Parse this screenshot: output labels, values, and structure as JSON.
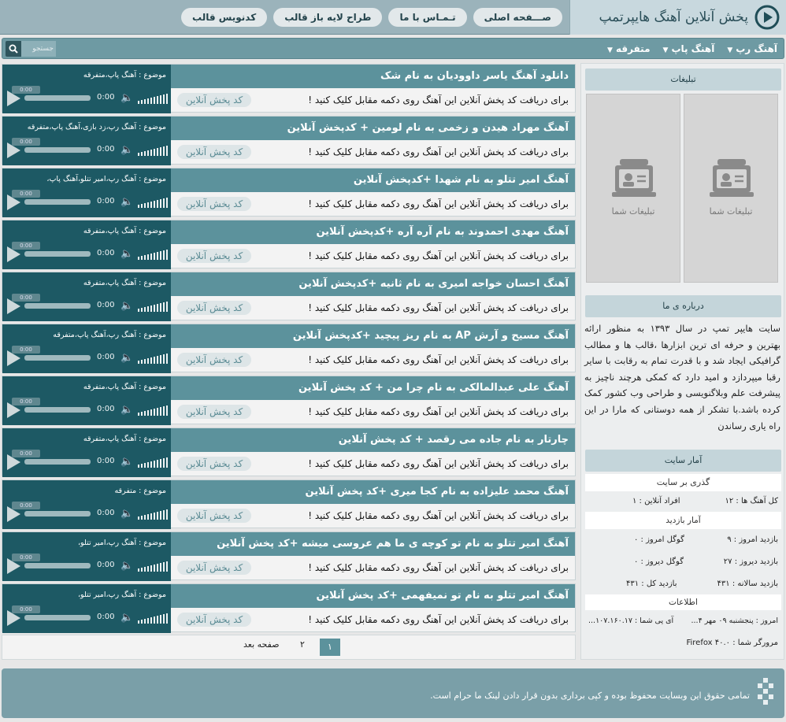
{
  "header": {
    "title": "پخش آنلاین آهنگ هایپرتمپ",
    "nav": [
      "صـــفحه اصلی",
      "تـمـاس با ما",
      "طراح لایه باز قالب",
      "کدنویس قالب"
    ]
  },
  "categories": [
    "آهنگ رپ",
    "آهنگ پاپ",
    "متفرقه"
  ],
  "search": {
    "placeholder": "جستجو"
  },
  "posts": [
    {
      "title": "دانلود آهنگ یاسر داوودیان به نام شک",
      "topic": "موضوع : آهنگ پاپ،متفرقه"
    },
    {
      "title": "آهنگ مهراد هیدن و زخمی به نام لومین + کدپخش آنلاین",
      "topic": "موضوع : آهنگ رپ،زد بازی،آهنگ پاپ،متفرقه"
    },
    {
      "title": "آهنگ امیر تتلو به نام شهدا +کدپخش آنلاین",
      "topic": "موضوع : آهنگ رپ،امیر تتلو،آهنگ پاپ،"
    },
    {
      "title": "آهنگ مهدی احمدوند به نام آره آره +کدپخش آنلاین",
      "topic": "موضوع : آهنگ پاپ،متفرقه"
    },
    {
      "title": "آهنگ احسان خواجه امیری به نام ثانیه +کدپخش آنلاین",
      "topic": "موضوع : آهنگ پاپ،متفرقه"
    },
    {
      "title": "آهنگ مسیح و آرش AP به نام ریز پیچید +کدپخش آنلاین",
      "topic": "موضوع : آهنگ رپ،آهنگ پاپ،متفرقه"
    },
    {
      "title": "آهنگ علی عبدالمالکی به نام چرا من + کد پخش آنلاین",
      "topic": "موضوع : آهنگ پاپ،متفرقه"
    },
    {
      "title": "چارتار به نام جاده می رقصد + کد پخش آنلاین",
      "topic": "موضوع : آهنگ پاپ،متفرقه"
    },
    {
      "title": "آهنگ محمد علیزاده به نام کجا میری +کد پخش آنلاین",
      "topic": "موضوع : متفرقه"
    },
    {
      "title": "آهنگ امیر تتلو به نام تو کوچه ی ما هم عروسی میشه +کد پخش آنلاین",
      "topic": "موضوع : آهنگ رپ،امیر تتلو،"
    },
    {
      "title": "آهنگ امیر تتلو به نام تو نمیفهمی +کد پخش آنلاین",
      "topic": "موضوع : آهنگ رپ،امیر تتلو،"
    }
  ],
  "post_common": {
    "desc": "برای دریافت کد پخش آنلاین این آهنگ روی دکمه مقابل کلیک کنید !",
    "code_label": "کد پخش آنلاین",
    "time": "0:00",
    "tooltip": "0:00"
  },
  "pager": {
    "current": "۱",
    "next": "۲",
    "next_label": "صفحه بعد"
  },
  "sidebar": {
    "ads": {
      "title": "تبلیغات",
      "label": "تبلیغات شما"
    },
    "about": {
      "title": "درباره ی ما",
      "text": "سایت هایپر تمپ در سال ۱۳۹۳ به منظور ارائه بهترین و حرفه ای ترین ابزارها ،قالب ها و مطالب گرافیکی ایجاد شد و با قدرت تمام به رقابت با سایر رقبا میپردازد و امید دارد که کمکی هرچند ناچیز به پیشرفت علم وبلاگنویسی و طراحی وب کشور کمک کرده باشد.با تشکر از همه دوستانی که مارا در این راه یاری رساندن"
    },
    "stats": {
      "title": "آمار سایت",
      "overview_title": "گذری بر سایت",
      "total_songs": "کل آهنگ ها : ۱۲",
      "online": "افراد آنلاین : ۱",
      "visits_title": "آمار بازدید",
      "today": "بازدید امروز : ۹",
      "google_today": "گوگل امروز : ۰",
      "yesterday": "بازدید دیروز : ۲۷",
      "google_yesterday": "گوگل دیروز : ۰",
      "yearly": "بازدید سالانه : ۴۳۱",
      "total": "بازدید کل : ۴۳۱",
      "info_title": "اطلاعات",
      "today_date": "امروز : پنجشنبه ۰۹ مهر ۴...",
      "ip": "آی پی شما : ۱۰۷.۱۶۰.۱۷...",
      "browser": "مرورگر شما : Firefox ۴۰.۰"
    }
  },
  "footer": {
    "text": "تمامی حقوق این وبسایت محفوظ بوده و کپی برداری بدون قرار دادن لینک ما حرام است."
  }
}
